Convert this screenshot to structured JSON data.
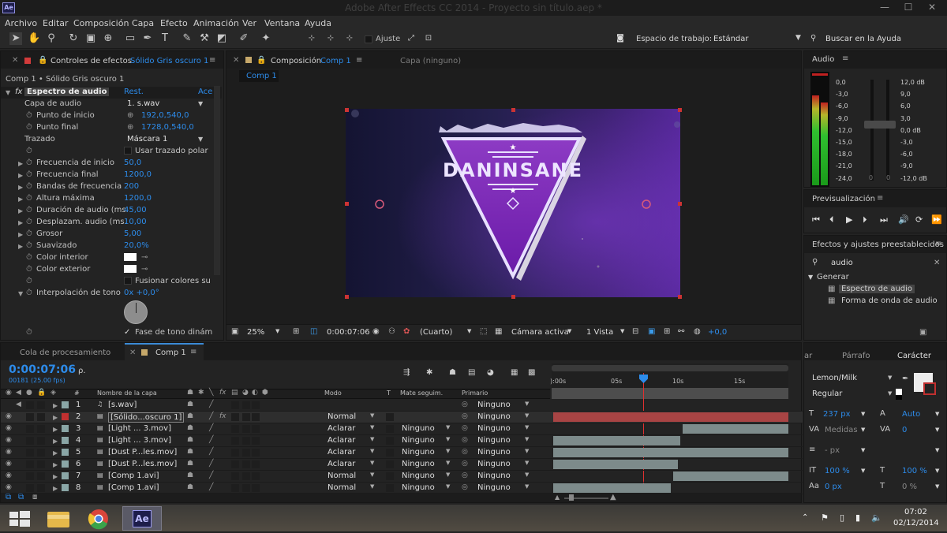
{
  "window": {
    "title": "Adobe After Effects CC 2014 - Proyecto sin título.aep *",
    "logo": "Ae",
    "minimize": "—",
    "maximize": "☐",
    "close": "✕"
  },
  "menu": [
    "Archivo",
    "Editar",
    "Composición",
    "Capa",
    "Efecto",
    "Animación",
    "Ver",
    "Ventana",
    "Ayuda"
  ],
  "toolbar": {
    "ajuste": "Ajuste",
    "workspace_label": "Espacio de trabajo:",
    "workspace_value": "Estándar",
    "help_search": "Buscar en la Ayuda"
  },
  "effects_panel": {
    "tab_label": "Controles de efectos",
    "tab_target": "Sólido Gris oscuro 1",
    "breadcrumb": "Comp 1 • Sólido Gris oscuro 1",
    "effect_name": "Espectro de audio",
    "reset": "Rest.",
    "about": "Ace",
    "rows": [
      {
        "label": "Capa de audio",
        "value": "1. s.wav"
      },
      {
        "label": "Punto de inicio",
        "value": "192,0,540,0"
      },
      {
        "label": "Punto final",
        "value": "1728,0,540,0"
      },
      {
        "label": "Trazado",
        "value": "Máscara 1"
      },
      {
        "label": "",
        "value": "Usar trazado polar"
      },
      {
        "label": "Frecuencia de inicio",
        "value": "50,0"
      },
      {
        "label": "Frecuencia final",
        "value": "1200,0"
      },
      {
        "label": "Bandas de frecuencia",
        "value": "200"
      },
      {
        "label": "Altura máxima",
        "value": "1200,0"
      },
      {
        "label": "Duración de audio (ms.",
        "value": "45,00"
      },
      {
        "label": "Desplazam. audio (ms.",
        "value": "10,00"
      },
      {
        "label": "Grosor",
        "value": "5,00"
      },
      {
        "label": "Suavizado",
        "value": "20,0%"
      },
      {
        "label": "Color interior",
        "value": ""
      },
      {
        "label": "Color exterior",
        "value": ""
      },
      {
        "label": "",
        "value": "Fusionar colores su"
      },
      {
        "label": "Interpolación de tono",
        "value": "0x +0,0°"
      },
      {
        "label": "",
        "value": "Fase de tono dinám"
      }
    ]
  },
  "comp_panel": {
    "tab_label": "Composición",
    "tab_target": "Comp 1",
    "layer_tab": "Capa (ninguno)",
    "subtab": "Comp 1",
    "logo_text": "DANINSANE",
    "footer": {
      "zoom": "25%",
      "timecode": "0:00:07:06",
      "resolution": "(Cuarto)",
      "camera": "Cámara activa",
      "views": "1 Vista",
      "exposure": "+0,0"
    }
  },
  "audio_panel": {
    "title": "Audio",
    "left_scale": [
      "0,0",
      "-3,0",
      "-6,0",
      "-9,0",
      "-12,0",
      "-15,0",
      "-18,0",
      "-21,0",
      "-24,0"
    ],
    "right_scale": [
      "12,0 dB",
      "9,0",
      "6,0",
      "3,0",
      "0,0 dB",
      "-3,0",
      "-6,0",
      "-9,0",
      "-12,0 dB"
    ],
    "zero_left": "0",
    "zero_right": "0",
    "level_left_pct": 78,
    "level_right_pct": 72
  },
  "preview_panel": {
    "title": "Previsualización"
  },
  "effects_presets": {
    "title": "Efectos y ajustes preestablecidos",
    "search": "audio",
    "category": "Generar",
    "items": [
      "Espectro de audio",
      "Forma de onda de audio"
    ]
  },
  "character_panel": {
    "tab_partial": "ar",
    "tab_paragraph": "Párrafo",
    "tab_character": "Carácter",
    "font": "Lemon/Milk",
    "style": "Regular",
    "size": "237 px",
    "leading": "Auto",
    "kerning": "Medidas",
    "tracking": "0",
    "stroke": "- px",
    "vscale": "100 %",
    "hscale": "100 %",
    "baseline": "0 px",
    "tsume": "0 %"
  },
  "timeline": {
    "tab_queue": "Cola de procesamiento",
    "tab_comp": "Comp 1",
    "timecode": "0:00:07:06",
    "frames": "00181 (25.00 fps)",
    "search": "ρ.",
    "col_num": "#",
    "col_name": "Nombre de la capa",
    "col_mode": "Modo",
    "col_t": "T",
    "col_track": "Mate seguim.",
    "col_parent": "Primario",
    "ruler": [
      "):00s",
      "05s",
      "10s",
      "15s"
    ],
    "layers": [
      {
        "num": "1",
        "name": "[s.wav]",
        "mode": "",
        "track": "",
        "parent": "Ninguno",
        "color": "#8aa6a6",
        "bar": [
          0,
          0
        ],
        "bar_color": "#4d4d4d"
      },
      {
        "num": "2",
        "name": "[Sólido...oscuro 1]",
        "mode": "Normal",
        "track": "",
        "parent": "Ninguno",
        "color": "#c03030",
        "bar": [
          0,
          100
        ],
        "bar_color": "#a84444"
      },
      {
        "num": "3",
        "name": "[Light ... 3.mov]",
        "mode": "Aclarar",
        "track": "Ninguno",
        "parent": "Ninguno",
        "color": "#8aa6a6",
        "bar": [
          55,
          100
        ],
        "bar_color": "#7d8b8b"
      },
      {
        "num": "4",
        "name": "[Light ... 3.mov]",
        "mode": "Aclarar",
        "track": "Ninguno",
        "parent": "Ninguno",
        "color": "#8aa6a6",
        "bar": [
          0,
          54
        ],
        "bar_color": "#7d8b8b"
      },
      {
        "num": "5",
        "name": "[Dust P...les.mov]",
        "mode": "Aclarar",
        "track": "Ninguno",
        "parent": "Ninguno",
        "color": "#8aa6a6",
        "bar": [
          0,
          100
        ],
        "bar_color": "#7d8b8b"
      },
      {
        "num": "6",
        "name": "[Dust P...les.mov]",
        "mode": "Aclarar",
        "track": "Ninguno",
        "parent": "Ninguno",
        "color": "#8aa6a6",
        "bar": [
          0,
          53
        ],
        "bar_color": "#7d8b8b"
      },
      {
        "num": "7",
        "name": "[Comp 1.avi]",
        "mode": "Normal",
        "track": "Ninguno",
        "parent": "Ninguno",
        "color": "#8aa6a6",
        "bar": [
          51,
          100
        ],
        "bar_color": "#7d8b8b"
      },
      {
        "num": "8",
        "name": "[Comp 1.avi]",
        "mode": "Normal",
        "track": "Ninguno",
        "parent": "Ninguno",
        "color": "#8aa6a6",
        "bar": [
          0,
          50
        ],
        "bar_color": "#7d8b8b"
      }
    ]
  },
  "taskbar": {
    "time": "07:02",
    "date": "02/12/2014"
  }
}
